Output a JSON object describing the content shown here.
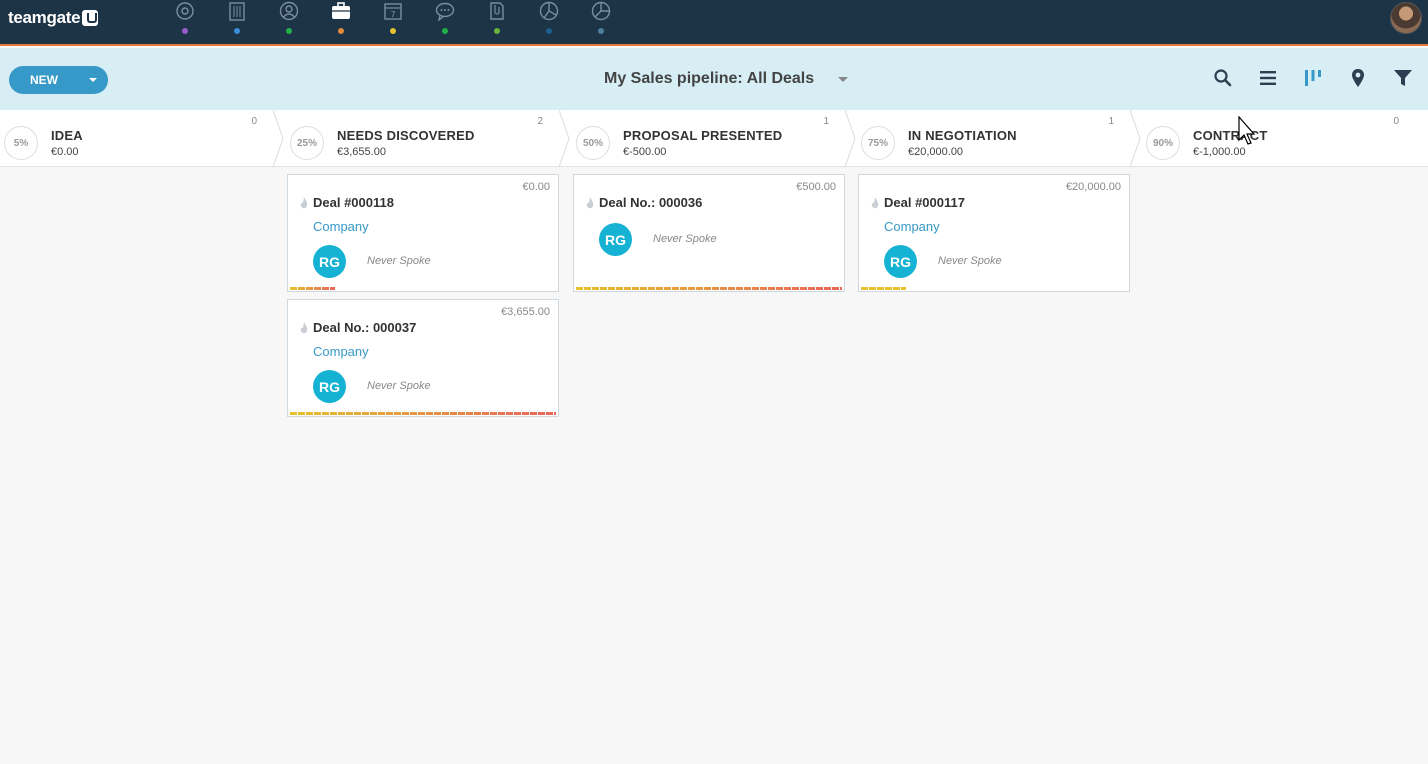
{
  "app": {
    "logo_text": "teamgate"
  },
  "nav": [
    {
      "name": "dashboard-icon",
      "dot": "#9b59d0"
    },
    {
      "name": "companies-icon",
      "dot": "#3b8fd8"
    },
    {
      "name": "people-icon",
      "dot": "#22b04a"
    },
    {
      "name": "deals-icon",
      "dot": "#e08a3a"
    },
    {
      "name": "calendar-icon",
      "dot": "#e6c12d"
    },
    {
      "name": "chat-icon",
      "dot": "#22b04a"
    },
    {
      "name": "documents-icon",
      "dot": "#6bb33a"
    },
    {
      "name": "reports-icon",
      "dot": "#1c5f8e"
    },
    {
      "name": "analytics-icon",
      "dot": "#4f7f9a"
    }
  ],
  "toolbar": {
    "new_label": "NEW",
    "pipeline_title": "My Sales pipeline: All Deals",
    "icons": [
      "search-icon",
      "list-view-icon",
      "kanban-view-icon",
      "map-pin-icon",
      "filter-icon"
    ]
  },
  "stages": [
    {
      "pct": "5%",
      "name": "IDEA",
      "amount": "€0.00",
      "count": "0"
    },
    {
      "pct": "25%",
      "name": "NEEDS DISCOVERED",
      "amount": "€3,655.00",
      "count": "2"
    },
    {
      "pct": "50%",
      "name": "PROPOSAL PRESENTED",
      "amount": "€-500.00",
      "count": "1"
    },
    {
      "pct": "75%",
      "name": "IN NEGOTIATION",
      "amount": "€20,000.00",
      "count": "1"
    },
    {
      "pct": "90%",
      "name": "CONTRACT",
      "amount": "€-1,000.00",
      "count": "0"
    }
  ],
  "cards": [
    {
      "title": "Deal #000118",
      "amount": "€0.00",
      "company": "Company",
      "avatar": "RG",
      "status": "Never Spoke",
      "progress": 0.17,
      "bar_color": "#e8655a"
    },
    {
      "title": "Deal No.: 000037",
      "amount": "€3,655.00",
      "company": "Company",
      "avatar": "RG",
      "status": "Never Spoke",
      "progress": 1.0,
      "bar_color": "#e8655a"
    },
    {
      "title": "Deal No.: 000036",
      "amount": "€500.00",
      "company": "",
      "avatar": "RG",
      "status": "Never Spoke",
      "progress": 1.0,
      "bar_color": "#e8655a"
    },
    {
      "title": "Deal #000117",
      "amount": "€20,000.00",
      "company": "Company",
      "avatar": "RG",
      "status": "Never Spoke",
      "progress": 0.17,
      "bar_color": "#e6c12d"
    }
  ]
}
